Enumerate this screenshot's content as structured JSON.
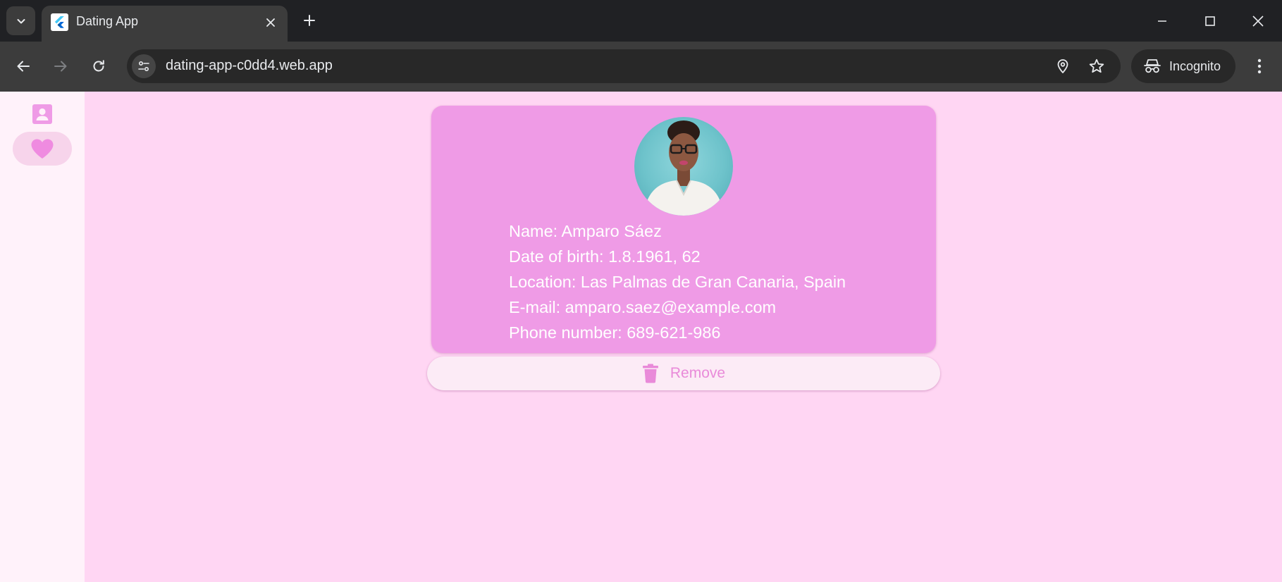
{
  "browser": {
    "tab": {
      "title": "Dating App"
    },
    "url": "dating-app-c0dd4.web.app",
    "incognito_label": "Incognito"
  },
  "nav_rail": {
    "items": [
      {
        "name": "profile",
        "icon": "account-box-icon",
        "selected": false
      },
      {
        "name": "favorites",
        "icon": "heart-icon",
        "selected": true
      }
    ]
  },
  "profile": {
    "name_line": "Name: Amparo Sáez",
    "dob_line": "Date of birth: 1.8.1961, 62",
    "location_line": "Location: Las Palmas de Gran Canaria, Spain",
    "email_line": "E-mail: amparo.saez@example.com",
    "phone_line": "Phone number: 689-621-986"
  },
  "remove_button": {
    "label": "Remove",
    "icon": "trash-icon"
  },
  "colors": {
    "background": "#ffd6f3",
    "rail": "#fff2fa",
    "card": "#ef9be6",
    "accent": "#e98ad9"
  }
}
